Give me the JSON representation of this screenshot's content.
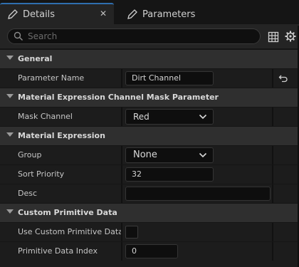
{
  "tabs": [
    {
      "label": "Details",
      "icon": "pencil-icon",
      "close": "✕"
    },
    {
      "label": "Parameters",
      "icon": "pencil-icon"
    }
  ],
  "search": {
    "placeholder": "Search"
  },
  "toolbar": {
    "icons": [
      "grid-view-icon",
      "gear-icon"
    ]
  },
  "sections": {
    "general": {
      "title": "General",
      "properties": {
        "parameter_name": {
          "label": "Parameter Name",
          "value": "Dirt Channel"
        }
      }
    },
    "channel_mask": {
      "title": "Material Expression Channel Mask Parameter",
      "properties": {
        "mask_channel": {
          "label": "Mask Channel",
          "value": "Red"
        }
      }
    },
    "material_expression": {
      "title": "Material Expression",
      "properties": {
        "group": {
          "label": "Group",
          "value": "None"
        },
        "sort_priority": {
          "label": "Sort Priority",
          "value": "32"
        },
        "desc": {
          "label": "Desc",
          "value": ""
        }
      }
    },
    "custom_primitive": {
      "title": "Custom Primitive Data",
      "properties": {
        "use_custom": {
          "label": "Use Custom Primitive Data",
          "checked": false
        },
        "data_index": {
          "label": "Primitive Data Index",
          "value": "0"
        }
      }
    }
  },
  "colors": {
    "accent": "#2f6fb0",
    "panel": "#242424",
    "category": "#2f2f2f",
    "row": "#1c1c1c"
  }
}
